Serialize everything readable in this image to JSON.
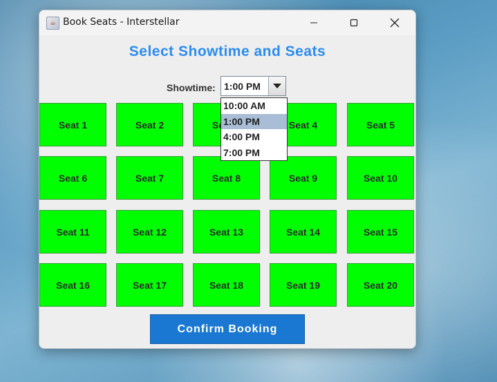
{
  "window": {
    "title": "Book Seats - Interstellar",
    "icon": "java-cup-icon"
  },
  "heading": "Select Showtime and Seats",
  "showtime": {
    "label": "Showtime:",
    "selected": "1:00 PM",
    "options": [
      "10:00 AM",
      "1:00 PM",
      "4:00 PM",
      "7:00 PM"
    ],
    "highlighted_index": 1
  },
  "seats": [
    "Seat 1",
    "Seat 2",
    "Seat 3",
    "Seat 4",
    "Seat 5",
    "Seat 6",
    "Seat 7",
    "Seat 8",
    "Seat 9",
    "Seat 10",
    "Seat 11",
    "Seat 12",
    "Seat 13",
    "Seat 14",
    "Seat 15",
    "Seat 16",
    "Seat 17",
    "Seat 18",
    "Seat 19",
    "Seat 20"
  ],
  "confirm_label": "Confirm Booking",
  "colors": {
    "seat_available": "#00ff00",
    "heading": "#2a8cf0",
    "confirm_button": "#1a78d2",
    "dropdown_highlight": "#a9bed6"
  }
}
